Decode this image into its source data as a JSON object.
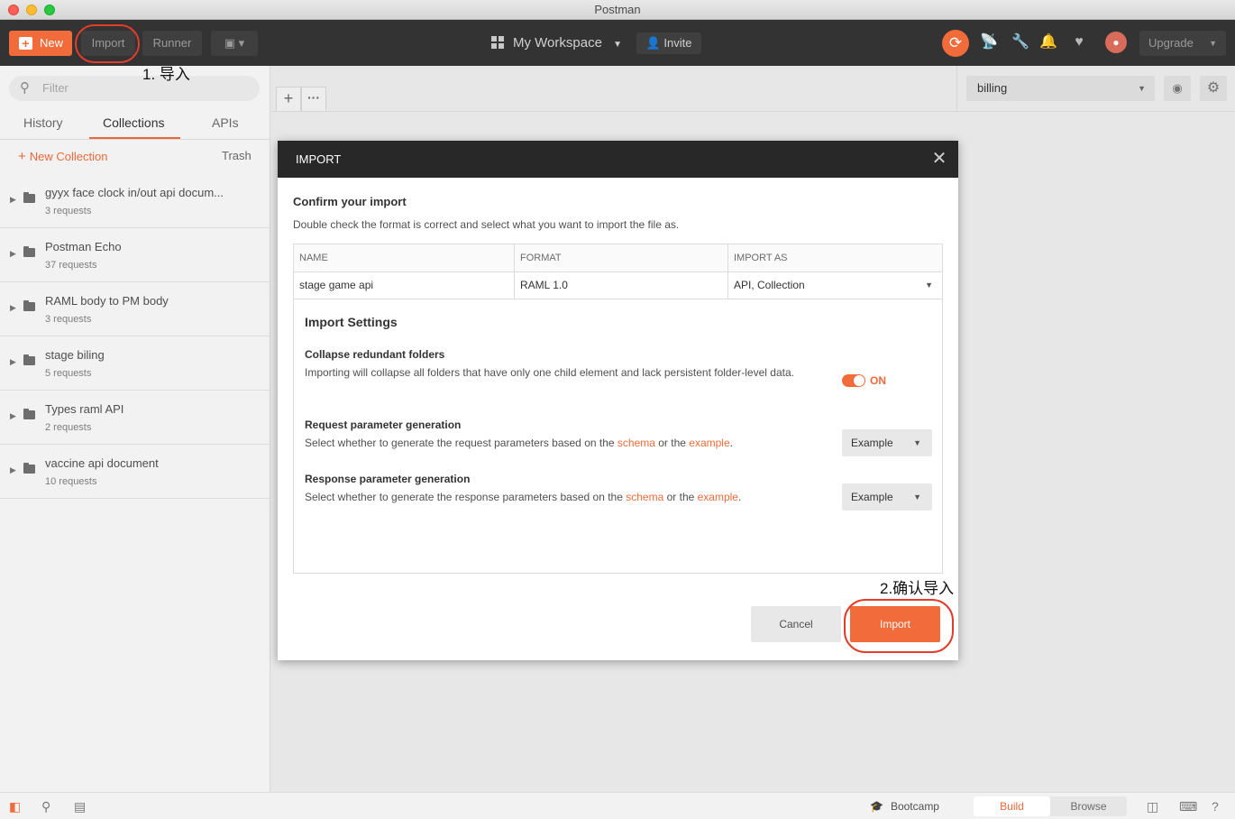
{
  "window": {
    "title": "Postman"
  },
  "header": {
    "new_label": "New",
    "import_label": "Import",
    "runner_label": "Runner",
    "workspace_label": "My Workspace",
    "invite_label": "Invite",
    "upgrade_label": "Upgrade"
  },
  "annotations": {
    "step1": "1. 导入",
    "step2": "2.确认导入"
  },
  "sidebar": {
    "filter_placeholder": "Filter",
    "tabs": [
      {
        "label": "History"
      },
      {
        "label": "Collections"
      },
      {
        "label": "APIs"
      }
    ],
    "active_tab": "Collections",
    "new_collection_label": "New Collection",
    "trash_label": "Trash",
    "collections": [
      {
        "name": "gyyx face clock in/out api docum...",
        "requests": "3 requests"
      },
      {
        "name": "Postman Echo",
        "requests": "37 requests"
      },
      {
        "name": "RAML body to PM body",
        "requests": "3 requests"
      },
      {
        "name": "stage biling",
        "requests": "5 requests"
      },
      {
        "name": "Types raml API",
        "requests": "2 requests"
      },
      {
        "name": "vaccine api document",
        "requests": "10 requests"
      }
    ]
  },
  "environment": {
    "selected": "billing"
  },
  "modal": {
    "title": "IMPORT",
    "heading": "Confirm your import",
    "description": "Double check the format is correct and select what you want to import the file as.",
    "table": {
      "headers": [
        "NAME",
        "FORMAT",
        "IMPORT AS"
      ],
      "row": {
        "name": "stage game api",
        "format": "RAML 1.0",
        "import_as": "API, Collection"
      }
    },
    "settings": {
      "heading": "Import Settings",
      "collapse": {
        "title": "Collapse redundant folders",
        "description": "Importing will collapse all folders that have only one child element and lack persistent folder-level data.",
        "toggle_label": "ON",
        "enabled": true
      },
      "request": {
        "title": "Request parameter generation",
        "desc_prefix": "Select whether to generate the request parameters based on the ",
        "link1": "schema",
        "desc_mid": " or the ",
        "link2": "example",
        "desc_suffix": ".",
        "value": "Example"
      },
      "response": {
        "title": "Response parameter generation",
        "desc_prefix": "Select whether to generate the response parameters based on the ",
        "link1": "schema",
        "desc_mid": " or the ",
        "link2": "example",
        "desc_suffix": ".",
        "value": "Example"
      }
    },
    "cancel_label": "Cancel",
    "import_label": "Import"
  },
  "statusbar": {
    "bootcamp_label": "Bootcamp",
    "build_label": "Build",
    "browse_label": "Browse"
  },
  "colors": {
    "accent": "#f26b3a",
    "header_bg": "#333333",
    "annotation_ring": "#e23d2b"
  }
}
